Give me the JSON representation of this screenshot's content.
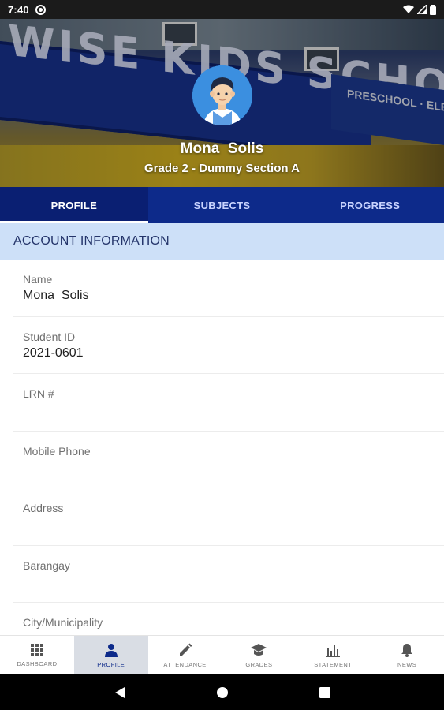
{
  "status_bar": {
    "time": "7:40"
  },
  "profile": {
    "name": "Mona  Solis",
    "section": "Grade 2 - Dummy Section A",
    "banner_text": "WISE KIDS SCHOOL",
    "banner_sub_text": "PRESCHOOL · ELEMENTARY"
  },
  "tabs": [
    {
      "label": "PROFILE",
      "active": true
    },
    {
      "label": "SUBJECTS",
      "active": false
    },
    {
      "label": "PROGRESS",
      "active": false
    }
  ],
  "account": {
    "header": "ACCOUNT INFORMATION",
    "fields": [
      {
        "label": "Name",
        "value": "Mona  Solis"
      },
      {
        "label": "Student ID",
        "value": "2021-0601"
      },
      {
        "label": "LRN #",
        "value": ""
      },
      {
        "label": "Mobile Phone",
        "value": ""
      },
      {
        "label": "Address",
        "value": ""
      },
      {
        "label": "Barangay",
        "value": ""
      },
      {
        "label": "City/Municipality",
        "value": ""
      }
    ]
  },
  "bottom_nav": [
    {
      "label": "DASHBOARD",
      "icon": "grid-icon",
      "active": false
    },
    {
      "label": "PROFILE",
      "icon": "person-icon",
      "active": true
    },
    {
      "label": "ATTENDANCE",
      "icon": "pencil-icon",
      "active": false
    },
    {
      "label": "GRADES",
      "icon": "graduation-cap-icon",
      "active": false
    },
    {
      "label": "STATEMENT",
      "icon": "bar-chart-icon",
      "active": false
    },
    {
      "label": "NEWS",
      "icon": "bell-icon",
      "active": false
    }
  ],
  "colors": {
    "primary": "#0d2a8a",
    "section_header_bg": "#cde0f8",
    "active_nav_bg": "#d9dde4",
    "avatar_bg": "#3b8fe0"
  }
}
